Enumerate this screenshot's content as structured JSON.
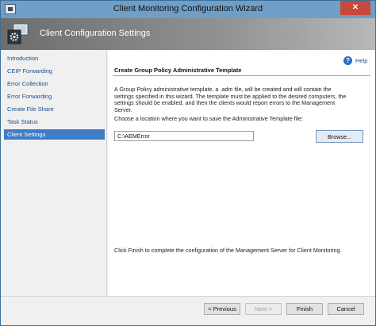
{
  "window": {
    "title": "Client Monitoring Configuration Wizard",
    "close_glyph": "✕"
  },
  "banner": {
    "title": "Client Configuration Settings",
    "icon": "gear-monitor-icon"
  },
  "nav": {
    "items": [
      {
        "label": "Introduction",
        "active": false
      },
      {
        "label": "CEIP Forwarding",
        "active": false
      },
      {
        "label": "Error Collection",
        "active": false
      },
      {
        "label": "Error Forwarding",
        "active": false
      },
      {
        "label": "Create File Share",
        "active": false
      },
      {
        "label": "Task Status",
        "active": false
      },
      {
        "label": "Client Settings",
        "active": true
      }
    ]
  },
  "main": {
    "help_label": "Help",
    "help_glyph": "?",
    "section_title": "Create Group Policy Administrative Template",
    "description": "A Group Policy administrative template, a .adm file, will be created and will contain the settings specified in this wizard. The template must be applied to the desired computers, the settings should be enabled, and then the clients would report errors to the Management Server.",
    "location_prompt": "Choose a location where you want to save the Administrative Template file:",
    "path_value": "C:\\AEMError",
    "browse_label": "Browse...",
    "finish_note": "Click Finish to complete the configuration of the Management Server for Client Monitoring."
  },
  "footer": {
    "previous_label": "< Previous",
    "next_label": "Next >",
    "next_enabled": false,
    "finish_label": "Finish",
    "cancel_label": "Cancel"
  },
  "colors": {
    "titlebar": "#6f9ec6",
    "nav_active": "#3f7cc3",
    "close_button": "#c7493b",
    "link_text": "#1b4c8c"
  }
}
